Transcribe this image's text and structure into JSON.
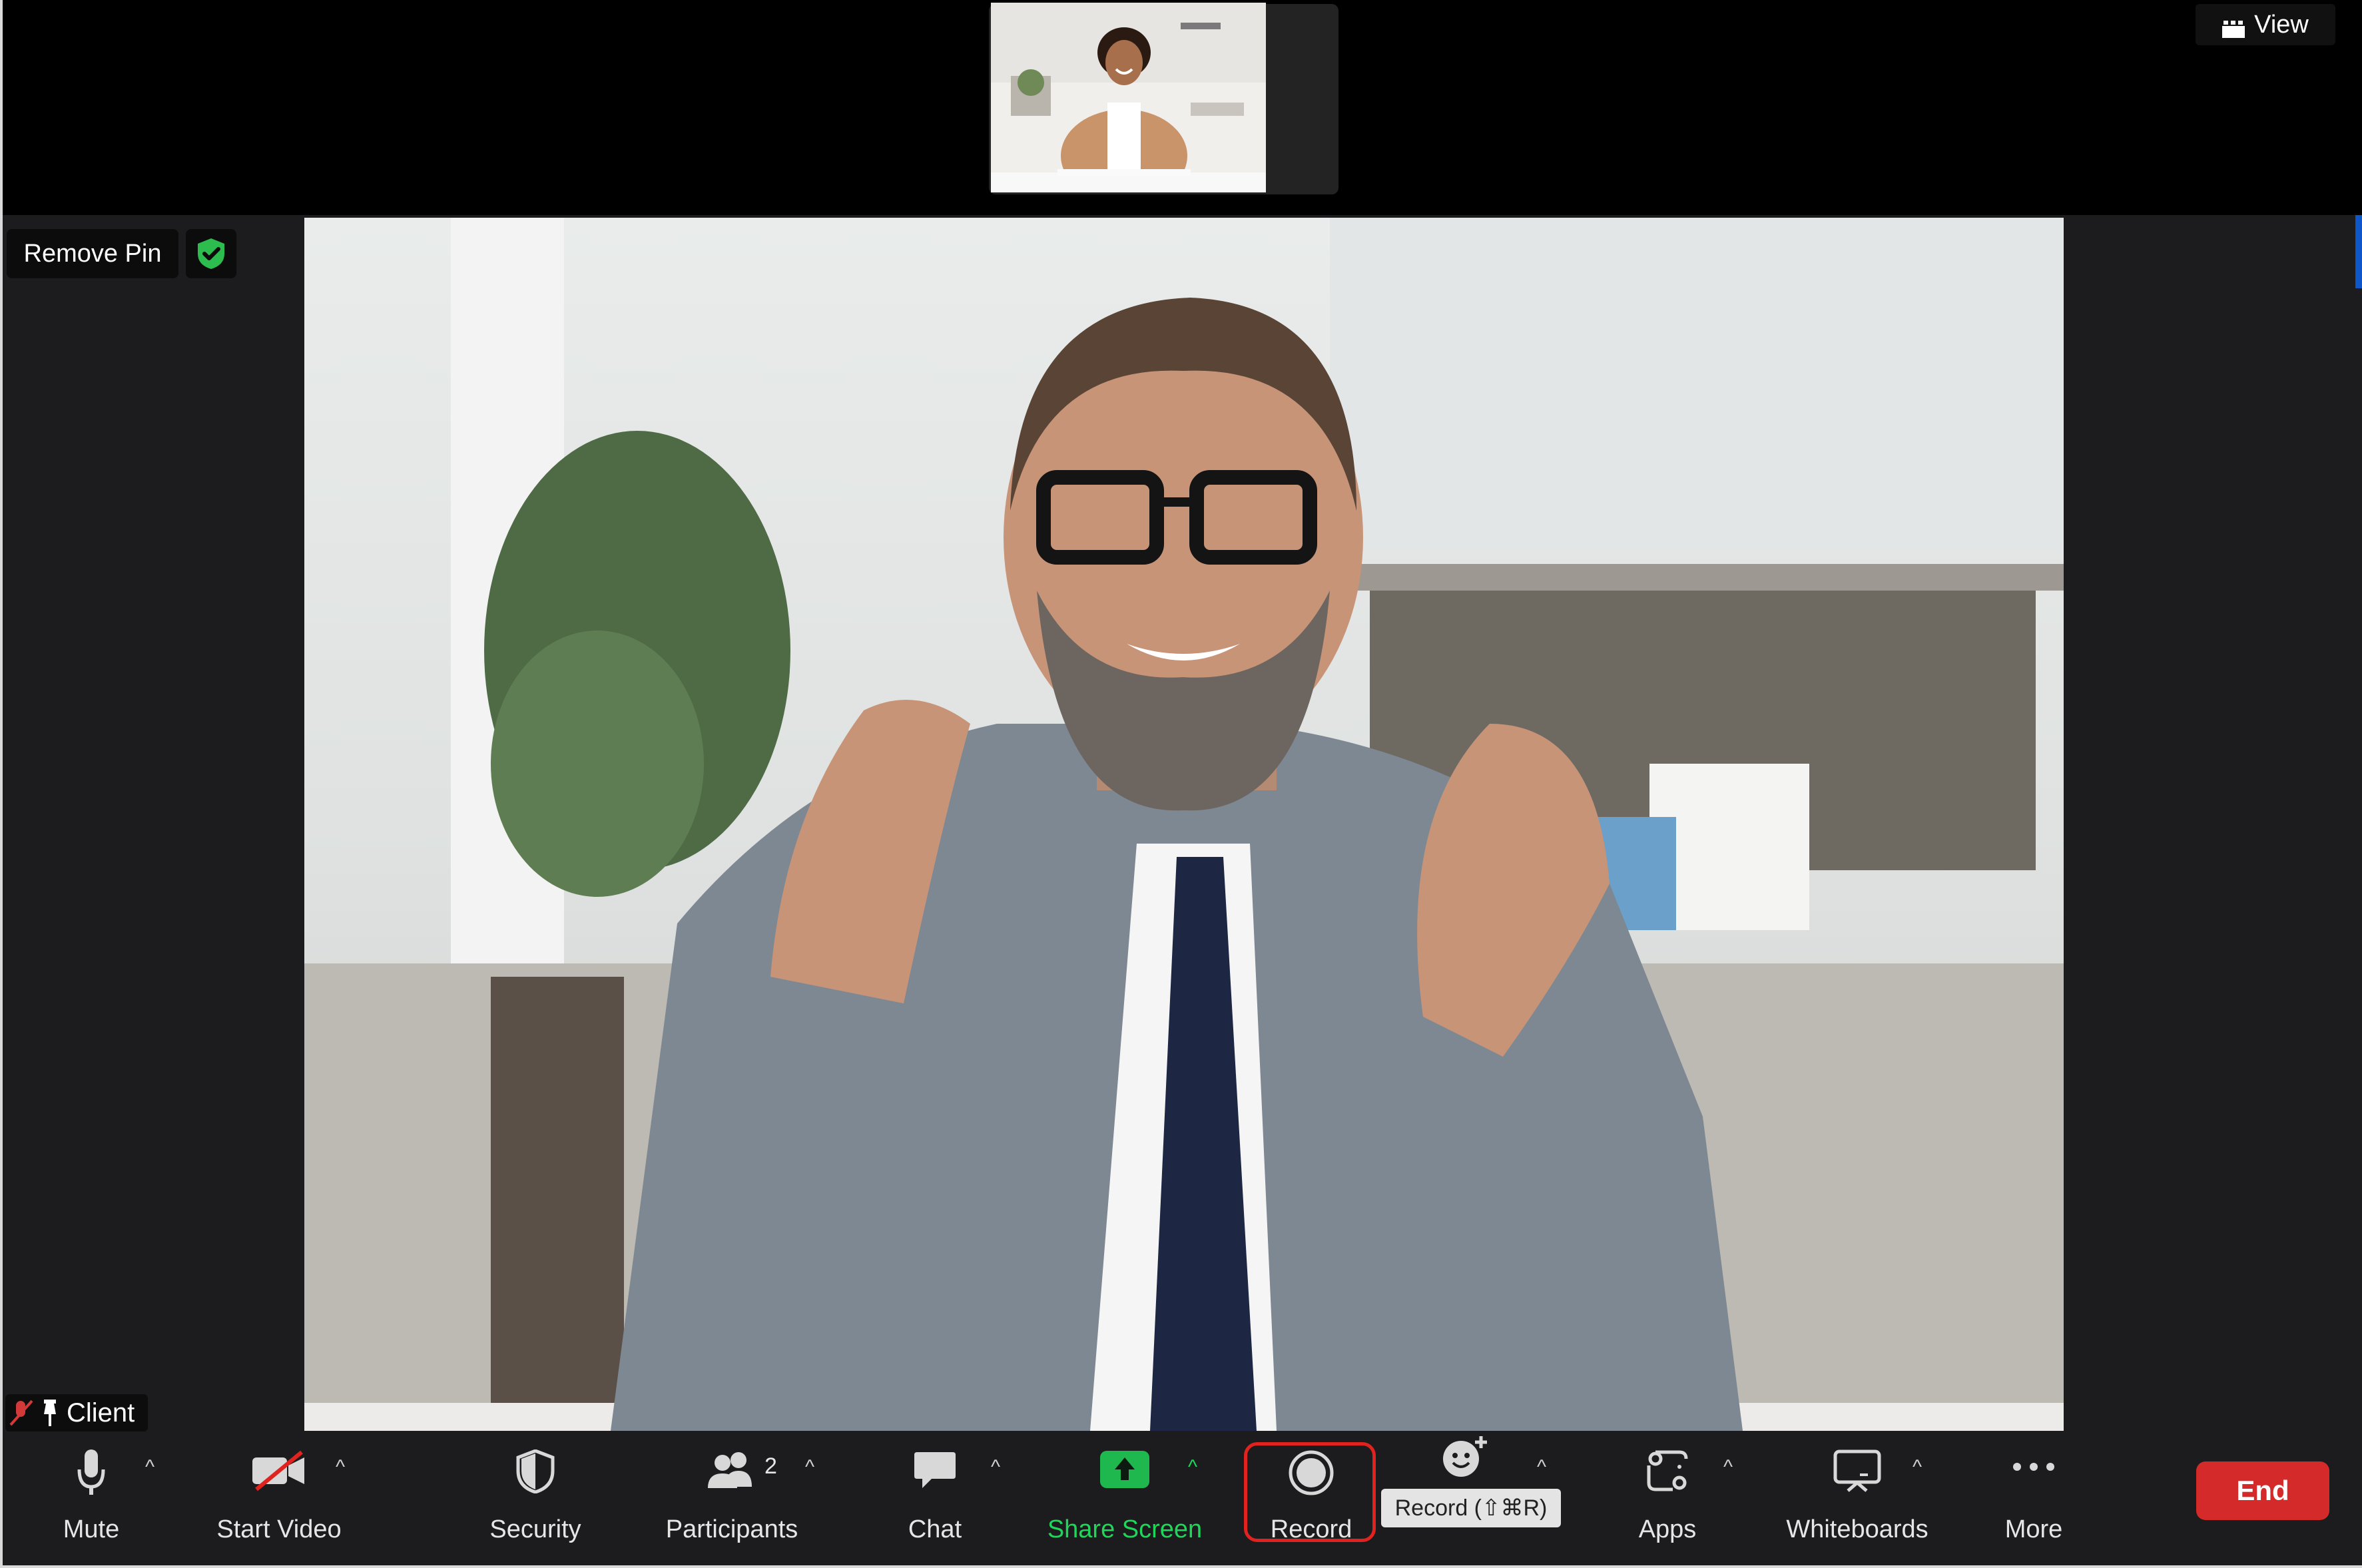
{
  "top_bar": {
    "view_label": "View"
  },
  "pin": {
    "remove_pin_label": "Remove Pin"
  },
  "participant": {
    "name": "Client"
  },
  "toolbar": {
    "mute_label": "Mute",
    "start_video_label": "Start Video",
    "security_label": "Security",
    "participants_label": "Participants",
    "participants_count": "2",
    "chat_label": "Chat",
    "share_screen_label": "Share Screen",
    "record_label": "Record",
    "record_tooltip": "Record (⇧⌘R)",
    "apps_label": "Apps",
    "whiteboards_label": "Whiteboards",
    "more_label": "More",
    "end_label": "End"
  },
  "colors": {
    "accent_green": "#1fd65b",
    "end_red": "#d42a2a",
    "highlight_red": "#e0231e"
  }
}
